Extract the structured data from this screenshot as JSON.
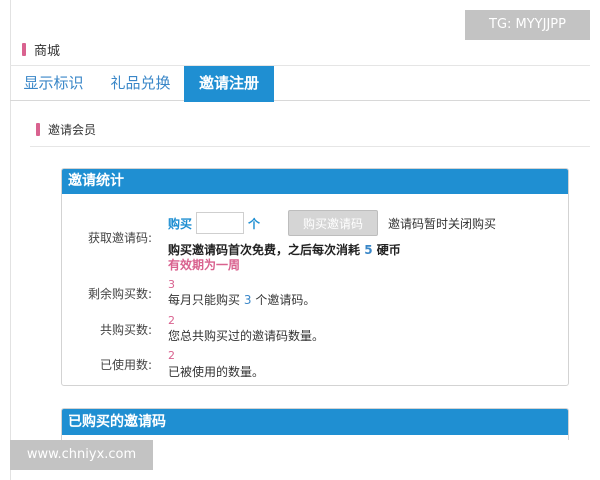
{
  "header": {
    "title": "商城"
  },
  "tabs": [
    {
      "label": "显示标识",
      "active": false
    },
    {
      "label": "礼品兑换",
      "active": false
    },
    {
      "label": "邀请注册",
      "active": true
    }
  ],
  "sub_header": {
    "title": "邀请会员"
  },
  "panel": {
    "title": "邀请统计",
    "get_code_label": "获取邀请码:",
    "buy_word": "购买",
    "qty_value": "",
    "unit_word": "个",
    "buy_button": "购买邀请码",
    "closed_note": "邀请码暂时关闭购买",
    "free_note_prefix": "购买邀请码首次免费，之后每次消耗",
    "cost": "5",
    "free_note_suffix": "硬币",
    "validity": "有效期为一周",
    "remaining_label": "剩余购买数:",
    "remaining_value": "3",
    "monthly_prefix": "每月只能购买",
    "monthly_count": "3",
    "monthly_suffix": "个邀请码。",
    "total_label": "共购买数:",
    "total_value": "2",
    "total_desc": "您总共购买过的邀请码数量。",
    "used_label": "已使用数:",
    "used_value": "2",
    "used_desc": "已被使用的数量。"
  },
  "panel2": {
    "title": "已购买的邀请码"
  },
  "watermarks": {
    "top_right": "TG: MYYJJPP",
    "bottom_left": "www.chniyx.com"
  },
  "colors": {
    "accent": "#1f8fd2",
    "pink": "#d9628f",
    "link": "#3a87c8"
  }
}
